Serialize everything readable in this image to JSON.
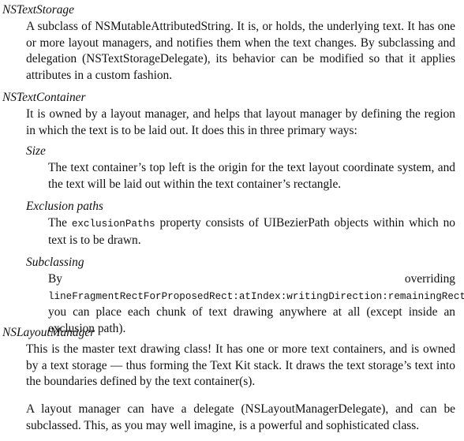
{
  "entries": {
    "text_storage": {
      "term": "NSTextStorage",
      "body": "A subclass of NSMutableAttributedString. It is, or holds, the underlying text. It has one or more layout managers, and notifies them when the text changes. By sub­classing and delegation (NSTextStorageDelegate), its behavior can be modified so that it applies attributes in a custom fashion."
    },
    "text_container": {
      "term": "NSTextContainer",
      "body": "It is owned by a layout manager, and helps that layout manager by defining the region in which the text is to be laid out. It does this in three primary ways:",
      "size": {
        "term": "Size",
        "body": "The text container’s top left is the origin for the text layout coordinate system, and the text will be laid out within the text container’s rectangle."
      },
      "exclusion_paths": {
        "term": "Exclusion paths",
        "body_before": "The ",
        "code": "exclusionPaths",
        "body_after": " property consists of UIBezierPath objects within which no text is to be drawn."
      },
      "subclassing": {
        "term": "Subclassing",
        "body_before": "By overriding ",
        "code": "lineFragmentRectForProposedRect:atIndex:writing­Direction:remainingRect:",
        "body_after": ", you can place each chunk of text drawing any­where at all (except inside an exclusion path)."
      }
    },
    "layout_manager": {
      "term": "NSLayoutManager",
      "body": "This is the master text drawing class! It has one or more text containers, and is owned by a text storage — thus forming the Text Kit stack. It draws the text storage’s text into the boundaries defined by the text container(s).",
      "body2": "A layout manager can have a delegate (NSLayoutManagerDelegate), and can be subclassed. This, as you may well imagine, is a powerful and sophisticated class."
    }
  }
}
